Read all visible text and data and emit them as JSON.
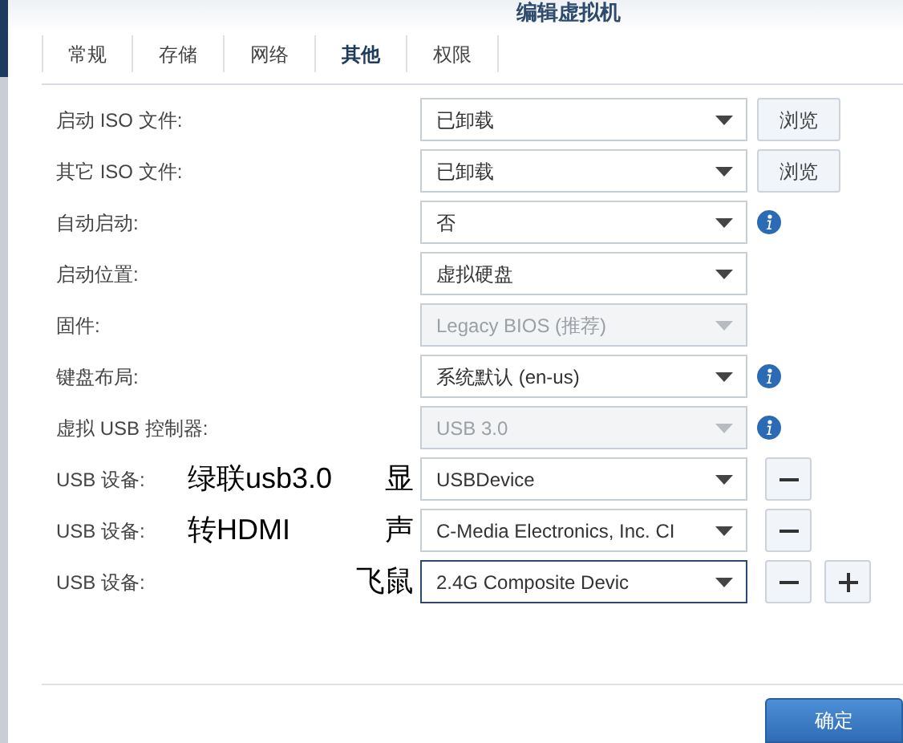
{
  "window": {
    "title": "编辑虚拟机"
  },
  "tabs": [
    {
      "label": "常规",
      "selected": false
    },
    {
      "label": "存储",
      "selected": false
    },
    {
      "label": "网络",
      "selected": false
    },
    {
      "label": "其他",
      "selected": true
    },
    {
      "label": "权限",
      "selected": false
    }
  ],
  "rows": [
    {
      "label": "启动 ISO 文件:",
      "value": "已卸载",
      "disabled": false,
      "focused": false,
      "trailing": [
        {
          "kind": "button",
          "label": "浏览"
        }
      ]
    },
    {
      "label": "其它 ISO 文件:",
      "value": "已卸载",
      "disabled": false,
      "focused": false,
      "trailing": [
        {
          "kind": "button",
          "label": "浏览"
        }
      ]
    },
    {
      "label": "自动启动:",
      "value": "否",
      "disabled": false,
      "focused": false,
      "trailing": [
        {
          "kind": "info"
        }
      ]
    },
    {
      "label": "启动位置:",
      "value": "虚拟硬盘",
      "disabled": false,
      "focused": false
    },
    {
      "label": "固件:",
      "value": "Legacy BIOS (推荐)",
      "disabled": true,
      "focused": false
    },
    {
      "label": "键盘布局:",
      "value": "系统默认 (en-us)",
      "disabled": false,
      "focused": false,
      "trailing": [
        {
          "kind": "info"
        }
      ]
    },
    {
      "label": "虚拟 USB 控制器:",
      "value": "USB 3.0",
      "disabled": true,
      "focused": false,
      "trailing": [
        {
          "kind": "info"
        }
      ]
    },
    {
      "label": "USB 设备:",
      "value": "USBDevice",
      "disabled": false,
      "focused": false,
      "note_left": "绿联usb3.0",
      "note_right": "显",
      "trailing": [
        {
          "kind": "remove"
        }
      ]
    },
    {
      "label": "USB 设备:",
      "value": "C-Media Electronics, Inc. CI",
      "disabled": false,
      "focused": false,
      "note_left": "转HDMI",
      "note_right": "声",
      "trailing": [
        {
          "kind": "remove"
        }
      ]
    },
    {
      "label": "USB 设备:",
      "value": "2.4G Composite Devic",
      "disabled": false,
      "focused": true,
      "note_right": "飞鼠",
      "trailing": [
        {
          "kind": "remove"
        },
        {
          "kind": "add"
        }
      ]
    }
  ],
  "footer": {
    "ok_button": "确定"
  }
}
